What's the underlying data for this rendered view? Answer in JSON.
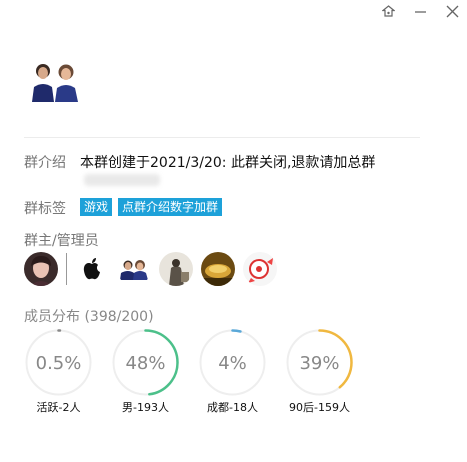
{
  "window": {
    "icons": [
      "pin-icon",
      "minimize-icon",
      "close-icon"
    ]
  },
  "intro": {
    "label": "群介绍",
    "text": "本群创建于2021/3/20:  此群关闭,退款请加总群"
  },
  "tags": {
    "label": "群标签",
    "items": [
      "游戏",
      "点群介绍数字加群"
    ],
    "color": "#1da1d9"
  },
  "admins": {
    "label": "群主/管理员"
  },
  "members": {
    "label": "成员分布 (398/200)",
    "stats": [
      {
        "pct": "0.5%",
        "fraction": 0.005,
        "caption": "活跃-2人",
        "color": "#888888"
      },
      {
        "pct": "48%",
        "fraction": 0.48,
        "caption": "男-193人",
        "color": "#4cc08a"
      },
      {
        "pct": "4%",
        "fraction": 0.04,
        "caption": "成都-18人",
        "color": "#5aa8d8"
      },
      {
        "pct": "39%",
        "fraction": 0.39,
        "caption": "90后-159人",
        "color": "#f0b840"
      }
    ]
  }
}
